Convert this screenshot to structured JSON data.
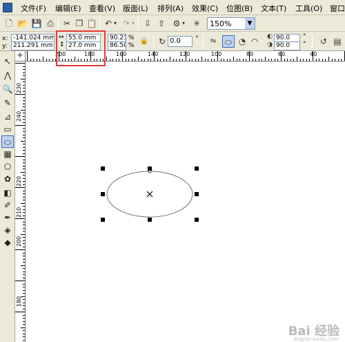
{
  "menu": [
    "文件(F)",
    "编辑(E)",
    "查看(V)",
    "版面(L)",
    "排列(A)",
    "效果(C)",
    "位图(B)",
    "文本(T)",
    "工具(O)",
    "窗口"
  ],
  "toolbar": {
    "zoom": "150%"
  },
  "property_bar": {
    "x": "-141.024 mm",
    "y": "211.291 mm",
    "width": "55.0 mm",
    "height": "27.0 mm",
    "scale_w": "90.23",
    "scale_h": "86.50",
    "percent": "%",
    "rotation": "0.0",
    "degree": "°",
    "start_angle": "90.0",
    "end_angle": "90.0",
    "x_label": "x:",
    "y_label": "y:"
  },
  "ruler_top": [
    "200",
    "180",
    "160",
    "140",
    "120",
    "100",
    "80",
    "60",
    "40"
  ],
  "ruler_left": [
    "230",
    "240",
    "220",
    "210",
    "200",
    "180",
    "160",
    "140",
    "120"
  ],
  "watermark": {
    "main": "Bai 经验",
    "sub": "jingyan.baidu.com"
  }
}
